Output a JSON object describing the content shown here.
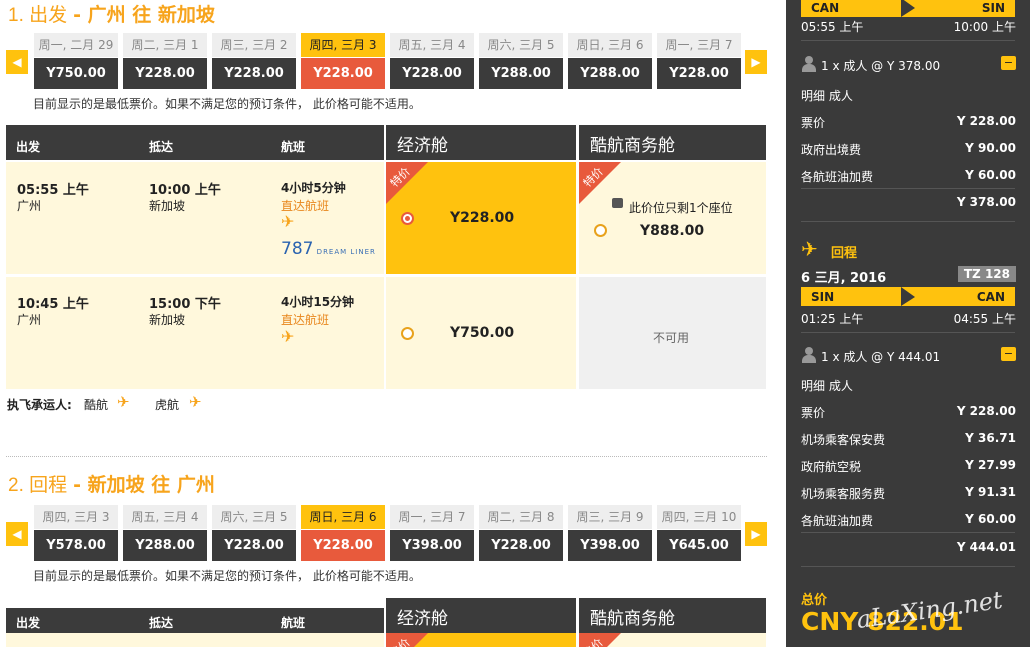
{
  "outbound": {
    "title_num": "1. 出发",
    "title_rest": "- 广州 往 新加坡",
    "dates": [
      {
        "label": "周一, 二月 29",
        "price": "Y750.00"
      },
      {
        "label": "周二, 三月 1",
        "price": "Y228.00"
      },
      {
        "label": "周三, 三月 2",
        "price": "Y228.00"
      },
      {
        "label": "周四, 三月 3",
        "price": "Y228.00"
      },
      {
        "label": "周五, 三月 4",
        "price": "Y228.00"
      },
      {
        "label": "周六, 三月 5",
        "price": "Y288.00"
      },
      {
        "label": "周日, 三月 6",
        "price": "Y288.00"
      },
      {
        "label": "周一, 三月 7",
        "price": "Y228.00"
      }
    ],
    "selected_index": 3,
    "note": "目前显示的是最低票价。如果不满足您的预订条件， 此价格可能不适用。",
    "headers": {
      "depart": "出发",
      "arrive": "抵达",
      "flight": "航班",
      "economy": "经济舱",
      "business": "酷航商务舱"
    },
    "flights": [
      {
        "dep_time": "05:55 上午",
        "dep_city": "广州",
        "arr_time": "10:00 上午",
        "arr_city": "新加坡",
        "duration": "4小时5分钟",
        "type": "直达航班",
        "aircraft": "787",
        "economy_price": "Y228.00",
        "economy_tag": "特价",
        "business_price": "Y888.00",
        "business_tag": "特价",
        "business_note": "此价位只剩1个座位"
      },
      {
        "dep_time": "10:45 上午",
        "dep_city": "广州",
        "arr_time": "15:00 下午",
        "arr_city": "新加坡",
        "duration": "4小时15分钟",
        "type": "直达航班",
        "economy_price": "Y750.00",
        "business_unavailable": "不可用"
      }
    ],
    "carriers_label": "执飞承运人:",
    "carriers": [
      "酷航",
      "虎航"
    ]
  },
  "inbound": {
    "title_num": "2. 回程",
    "title_rest": "- 新加坡 往 广州",
    "dates": [
      {
        "label": "周四, 三月 3",
        "price": "Y578.00"
      },
      {
        "label": "周五, 三月 4",
        "price": "Y288.00"
      },
      {
        "label": "周六, 三月 5",
        "price": "Y228.00"
      },
      {
        "label": "周日, 三月 6",
        "price": "Y228.00"
      },
      {
        "label": "周一, 三月 7",
        "price": "Y398.00"
      },
      {
        "label": "周二, 三月 8",
        "price": "Y228.00"
      },
      {
        "label": "周三, 三月 9",
        "price": "Y398.00"
      },
      {
        "label": "周四, 三月 10",
        "price": "Y645.00"
      }
    ],
    "selected_index": 3,
    "note": "目前显示的是最低票价。如果不满足您的预订条件， 此价格可能不适用。",
    "headers": {
      "depart": "出发",
      "arrive": "抵达",
      "flight": "航班",
      "economy": "经济舱",
      "business": "酷航商务舱"
    },
    "economy_tag": "特价",
    "business_tag": "特价"
  },
  "summary": {
    "out": {
      "from": "CAN",
      "to": "SIN",
      "dep": "05:55 上午",
      "arr": "10:00 上午",
      "pax": "1 x 成人 @ Y 378.00",
      "detail": "明细 成人",
      "lines": [
        [
          "票价",
          "Y 228.00"
        ],
        [
          "政府出境费",
          "Y 90.00"
        ],
        [
          "各航班油加费",
          "Y 60.00"
        ]
      ],
      "total": "Y 378.00"
    },
    "ret": {
      "label": "回程",
      "date": "6 三月, 2016",
      "flight_no": "TZ 128",
      "from": "SIN",
      "to": "CAN",
      "dep": "01:25 上午",
      "arr": "04:55 上午",
      "pax": "1 x 成人 @ Y 444.01",
      "detail": "明细 成人",
      "lines": [
        [
          "票价",
          "Y 228.00"
        ],
        [
          "机场乘客保安费",
          "Y 36.71"
        ],
        [
          "政府航空税",
          "Y 27.99"
        ],
        [
          "机场乘客服务费",
          "Y 91.31"
        ],
        [
          "各航班油加费",
          "Y 60.00"
        ]
      ],
      "total": "Y 444.01"
    },
    "grand_label": "总价",
    "grand_total": "CNY 822.01",
    "watermark": "aLaXing.net"
  },
  "colors": {
    "accent": "#ffc20e",
    "title": "#f7a41c",
    "selected": "#e85a3c",
    "dark": "#3b3b3b"
  }
}
